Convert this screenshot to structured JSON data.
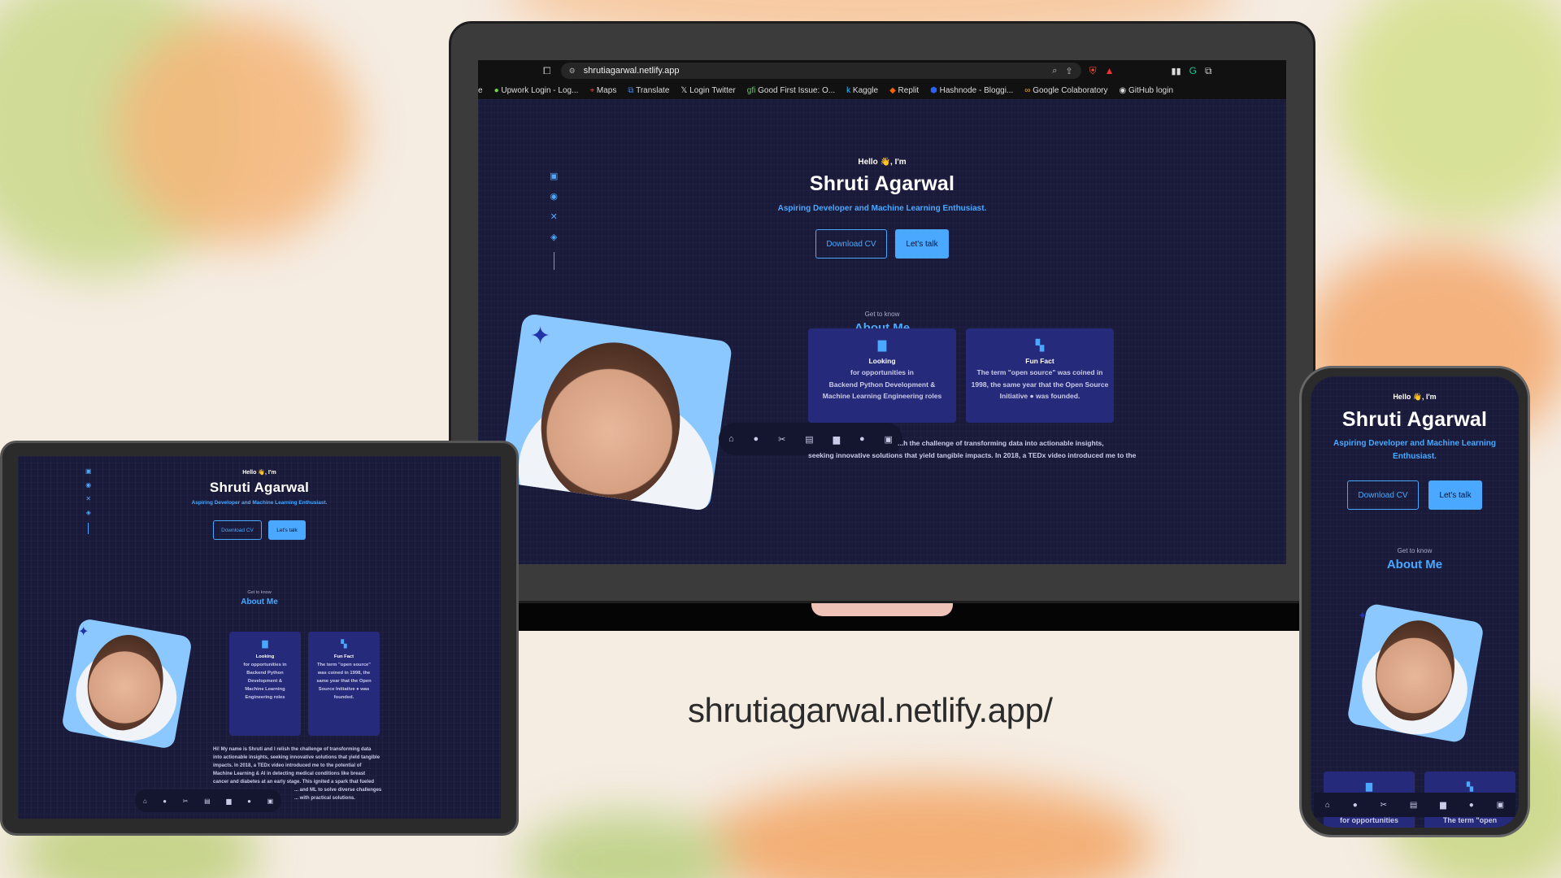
{
  "colors": {
    "accent": "#4aa8ff",
    "screen_bg": "#1a1b3a",
    "card_bg": "#262a7a"
  },
  "caption": "shrutiagarwal.netlify.app/",
  "browser": {
    "url": "shrutiagarwal.netlify.app",
    "bookmarks": [
      "Upwork Login - Log...",
      "Maps",
      "Translate",
      "Login Twitter",
      "Good First Issue: O...",
      "Kaggle",
      "Replit",
      "Hashnode - Bloggi...",
      "Google Colaboratory",
      "GitHub login"
    ],
    "bookmark_prefix": "e"
  },
  "site": {
    "hello": "Hello 👋, I'm",
    "name": "Shruti Agarwal",
    "tagline": "Aspiring Developer and Machine Learning Enthusiast.",
    "tagline_line1": "Aspiring Developer and Machine Learning",
    "tagline_line2": "Enthusiast.",
    "download_cv": "Download CV",
    "lets_talk": "Let's talk",
    "get_to_know": "Get to know",
    "about_me": "About Me",
    "card1_title": "Looking",
    "card1_desktop": [
      "for opportunities in",
      "Backend Python Development &",
      "Machine Learning Engineering roles"
    ],
    "card1_tablet": [
      "for opportunities in",
      "Backend Python",
      "Development &",
      "Machine Learning",
      "Engineering roles"
    ],
    "card1_phone": "for opportunities",
    "card2_title": "Fun Fact",
    "card2_desktop": [
      "The term \"open source\" was coined in",
      "1998, the same year that the Open Source",
      "Initiative ● was founded."
    ],
    "card2_tablet": [
      "The term \"open source\"",
      "was coined in 1998, the",
      "same year that the Open",
      "Source Initiative ● was",
      "founded."
    ],
    "card2_phone": "The term \"open",
    "bio_desktop": [
      "...h the challenge of transforming data into actionable insights,",
      "seeking innovative solutions that yield tangible impacts. In 2018, a TEDx video introduced me to the"
    ],
    "bio_tablet": [
      "Hi! My name is Shruti and I relish the challenge of transforming data",
      "into actionable insights, seeking innovative solutions that yield tangible",
      "impacts. In 2018, a TEDx video introduced me to the potential of",
      "Machine Learning & AI in detecting medical conditions like breast",
      "cancer and diabetes at an early stage. This ignited a spark that fueled",
      "... and ML to solve diverse challenges",
      "... with practical solutions."
    ]
  },
  "icons": {
    "social": [
      "linkedin-icon",
      "github-icon",
      "x-icon",
      "hashnode-icon"
    ],
    "nav": [
      "home-icon",
      "user-icon",
      "tools-icon",
      "projects-icon",
      "briefcase-icon",
      "circle-icon",
      "contact-icon"
    ]
  }
}
